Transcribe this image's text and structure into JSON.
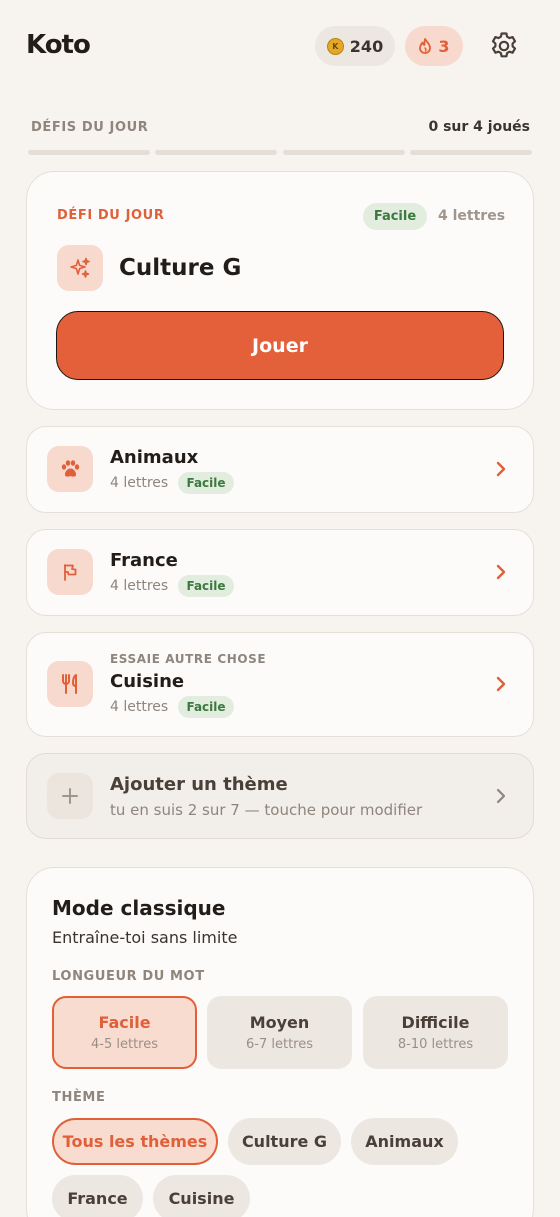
{
  "header": {
    "app_name": "Koto",
    "coin_symbol": "K",
    "coins": "240",
    "streak": "3",
    "coin_icon": "coin-icon",
    "streak_icon": "flame-icon",
    "settings_icon": "gear-icon"
  },
  "progress": {
    "label": "DÉFIS DU JOUR",
    "count": "0 sur 4 joués"
  },
  "daily": {
    "tag": "DÉFI DU JOUR",
    "difficulty": "Facile",
    "letters": "4 lettres",
    "title": "Culture G",
    "icon": "sparkles-icon",
    "play_label": "Jouer"
  },
  "themes": [
    {
      "title": "Animaux",
      "letters": "4 lettres",
      "difficulty": "Facile",
      "icon": "paw-icon"
    },
    {
      "title": "France",
      "letters": "4 lettres",
      "difficulty": "Facile",
      "icon": "flag-icon"
    },
    {
      "kicker": "ESSAIE AUTRE CHOSE",
      "title": "Cuisine",
      "letters": "4 lettres",
      "difficulty": "Facile",
      "icon": "utensils-icon"
    }
  ],
  "add_theme": {
    "title": "Ajouter un thème",
    "subtitle": "tu en suis 2 sur 7 — touche pour modifier",
    "icon": "plus-icon"
  },
  "classic": {
    "title": "Mode classique",
    "subtitle": "Entraîne-toi sans limite",
    "length_label": "LONGUEUR DU MOT",
    "lengths": [
      {
        "name": "Facile",
        "range": "4-5 lettres",
        "selected": true
      },
      {
        "name": "Moyen",
        "range": "6-7 lettres",
        "selected": false
      },
      {
        "name": "Difficile",
        "range": "8-10 lettres",
        "selected": false
      }
    ],
    "theme_label": "THÈME",
    "theme_options": [
      "Tous les thèmes",
      "Culture G",
      "Animaux",
      "France",
      "Cuisine"
    ],
    "selected_theme": "Tous les thèmes"
  },
  "colors": {
    "accent": "#e4603b",
    "accent_soft": "#f8d9cd",
    "easy_green": "#3a7a3e",
    "easy_bg": "#e2ecdf",
    "background": "#f7f4f0"
  }
}
